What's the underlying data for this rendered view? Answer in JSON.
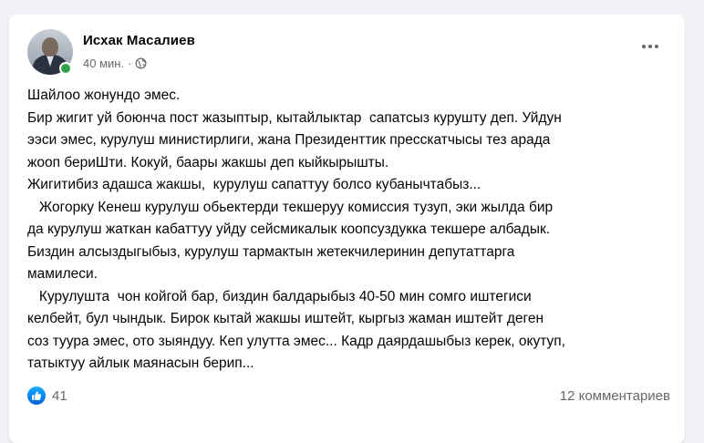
{
  "post": {
    "author": "Исхак Масалиев",
    "time": "40 мин.",
    "separator": "·",
    "privacy_icon": "globe-icon",
    "more_icon": "more-options-icon",
    "lines": [
      "Шайлоо жонундо эмес.",
      "Бир жигит уй боюнча пост жазыптыр, кытайлыктар  сапатсыз курушту деп. Уйдун",
      "ээси эмес, курулуш министирлиги, жана Президенттик пресскатчысы тез арада",
      "жооп бериШти. Кокуй, баары жакшы деп кыйкырышты.",
      "Жигитибиз адашса жакшы,  курулуш сапаттуу болсо кубанычтабыз...",
      "   Жогорку Кенеш курулуш обьектерди текшеруу комиссия тузуп, эки жылда бир",
      "да курулуш жаткан кабаттуу уйду сейсмикалык коопсуздукка текшере албадык.",
      "Биздин алсыздыгыбыз, курулуш тармактын жетекчилеринин депутаттарга",
      "мамилеси.",
      "   Курулушта  чон койгой бар, биздин балдарыбыз 40-50 мин сомго иштегиси",
      "келбейт, бул чындык. Бирок кытай жакшы иштейт, кыргыз жаман иштейт деген",
      "соз туура эмес, ото зыяндуу. Кеп улутта эмес... Кадр даярдашыбыз керек, окутуп,",
      "татыктуу айлык маянасын берип..."
    ]
  },
  "reactions": {
    "icon": "like-icon",
    "count": "41",
    "comments": "12 комментариев"
  },
  "colors": {
    "background": "#f0f2f5",
    "card": "#ffffff",
    "text": "#050505",
    "secondary": "#65676b",
    "online": "#31a24c",
    "like": "#0866ff"
  }
}
